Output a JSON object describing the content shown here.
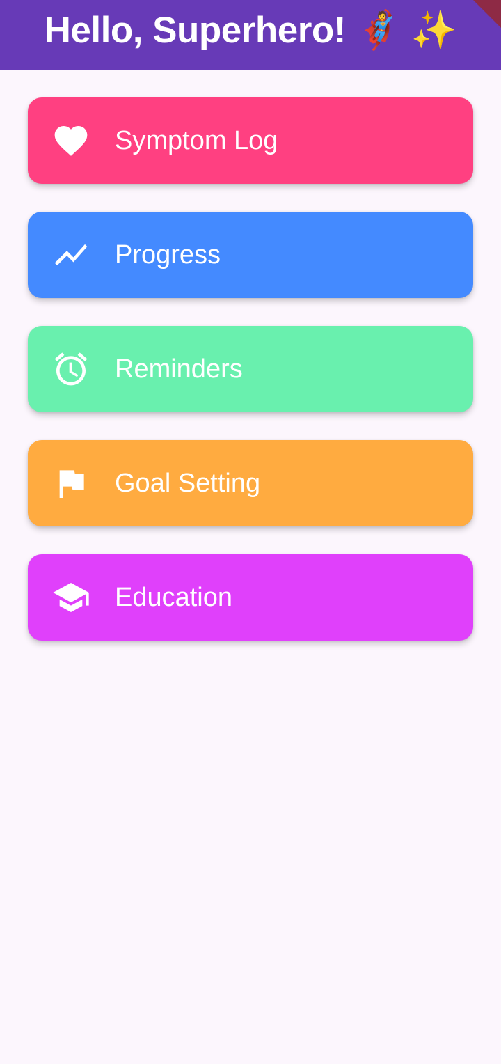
{
  "app_bar": {
    "title": "Hello, Superhero! 🦸 ✨",
    "color": "#673ab7"
  },
  "menu": {
    "items": [
      {
        "label": "Symptom Log",
        "icon": "heart-icon",
        "color": "#ff4081"
      },
      {
        "label": "Progress",
        "icon": "trending-up-icon",
        "color": "#448aff"
      },
      {
        "label": "Reminders",
        "icon": "alarm-icon",
        "color": "#69f0ae"
      },
      {
        "label": "Goal Setting",
        "icon": "flag-icon",
        "color": "#ffab40"
      },
      {
        "label": "Education",
        "icon": "school-icon",
        "color": "#e040fb"
      }
    ]
  }
}
